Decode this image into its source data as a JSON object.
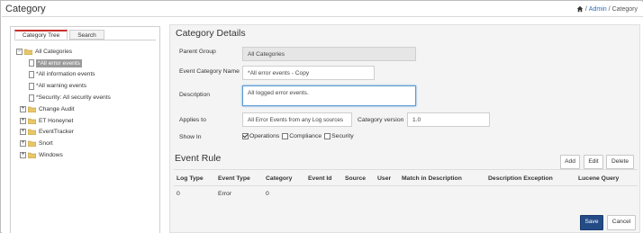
{
  "header": {
    "title": "Category",
    "breadcrumb": {
      "admin": "Admin",
      "separator1": "/",
      "separator2": "/",
      "current": "Category"
    }
  },
  "left_panel": {
    "tabs": [
      {
        "label": "Category Tree",
        "active": true
      },
      {
        "label": "Search",
        "active": false
      }
    ],
    "tree": {
      "root": "All Categories",
      "children": [
        "*All error events",
        "*All information events",
        "*All warning events",
        "*Security: All security events"
      ],
      "groups": [
        "Change Audit",
        "ET Honeynet",
        "EventTracker",
        "Snort",
        "Windows"
      ]
    }
  },
  "details": {
    "title": "Category Details",
    "parent_group_label": "Parent Group",
    "parent_group_value": "All Categories",
    "event_category_name_label": "Event Category Name",
    "event_category_name_value": "*All error events - Copy",
    "description_label": "Description",
    "description_value": "All logged error events.",
    "applies_to_label": "Applies to",
    "applies_to_value": "All Error Events from any Log sources",
    "category_version_label": "Category version",
    "category_version_value": "1.0",
    "show_in_label": "Show In",
    "show_in_options": [
      {
        "label": "Operations",
        "checked": true
      },
      {
        "label": "Compliance",
        "checked": false
      },
      {
        "label": "Security",
        "checked": false
      }
    ]
  },
  "event_rule": {
    "title": "Event Rule",
    "buttons": {
      "add": "Add",
      "edit": "Edit",
      "delete": "Delete"
    },
    "columns": [
      "Log Type",
      "Event Type",
      "Category",
      "Event Id",
      "Source",
      "User",
      "Match in Description",
      "Description Exception",
      "Lucene Query"
    ],
    "rows": [
      {
        "log_type": "0",
        "event_type": "Error",
        "category": "0"
      }
    ]
  },
  "footer": {
    "save": "Save",
    "cancel": "Cancel"
  },
  "colors": {
    "primary_button": "#234c87",
    "selected_node": "#9a9a9a",
    "active_tab_accent": "#c9302c",
    "link": "#2a6ebb"
  }
}
